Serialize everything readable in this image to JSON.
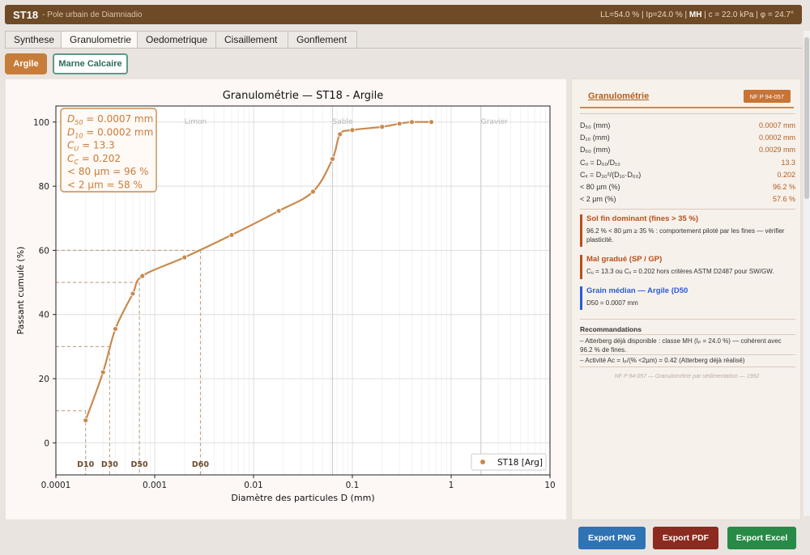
{
  "header": {
    "code": "ST18",
    "site": "- Pole urbain de Diamniadio",
    "props_pre": "LL=54.0 % | Ip=24.0 % |",
    "props_class": "MH",
    "props_post": "| c = 22.0 kPa | φ = 24.7°"
  },
  "tabs": [
    "Synthese",
    "Granulometrie",
    "Oedometrique",
    "Cisaillement",
    "Gonflement"
  ],
  "soils": [
    "Argile",
    "Marne Calcaire"
  ],
  "chart_data": {
    "type": "scatter",
    "title": "Granulométrie — ST18  - Argile",
    "xlabel": "Diamètre des particules D (mm)",
    "ylabel": "Passant cumulé (%)",
    "xscale": "log",
    "xlim": [
      0.0001,
      10
    ],
    "ylim": [
      -10,
      105
    ],
    "xticks": [
      0.0001,
      0.001,
      0.01,
      0.1,
      1,
      10
    ],
    "xtick_labels": [
      "0.0001",
      "0.001",
      "0.01",
      "0.1",
      "1",
      "10"
    ],
    "yticks": [
      0,
      20,
      40,
      60,
      80,
      100
    ],
    "grid": true,
    "legend": "bottom-right",
    "series": [
      {
        "name": "ST18  [Arg]",
        "color": "#c98a4e",
        "x": [
          0.0002,
          0.0003,
          0.0004,
          0.0006,
          0.00075,
          0.002,
          0.006,
          0.018,
          0.04,
          0.063,
          0.075,
          0.1,
          0.2,
          0.3,
          0.4,
          0.63
        ],
        "y": [
          7,
          22,
          35.5,
          46.5,
          52,
          57.8,
          64.8,
          72.3,
          78.3,
          88.5,
          96.2,
          97.5,
          98.5,
          99.5,
          100,
          100
        ]
      }
    ],
    "zones": [
      {
        "label": "Limon",
        "x": 0.002
      },
      {
        "label": "Sable",
        "x": 0.063
      },
      {
        "label": "Gravier",
        "x": 2
      }
    ],
    "markers": [
      {
        "label": "D10",
        "x": 0.0002,
        "y": 10
      },
      {
        "label": "D30",
        "x": 0.00035,
        "y": 30
      },
      {
        "label": "D50",
        "x": 0.0007,
        "y": 50
      },
      {
        "label": "D60",
        "x": 0.0029,
        "y": 60
      }
    ],
    "annotation": [
      {
        "sym": "D",
        "sub": "50",
        "text": " = 0.0007 mm"
      },
      {
        "sym": "D",
        "sub": "10",
        "text": " = 0.0002 mm"
      },
      {
        "sym": "C",
        "sub": "U",
        "text": "    = 13.3"
      },
      {
        "sym": "C",
        "sub": "C",
        "text": "    = 0.202"
      },
      {
        "sym": "",
        "sub": "",
        "text": "< 80 µm  = 96 %"
      },
      {
        "sym": "",
        "sub": "",
        "text": "< 2 µm   = 58 %"
      }
    ]
  },
  "sidebar": {
    "title": "Granulométrie",
    "norm_badge": "NF P 94-057",
    "params": [
      {
        "label": "D₅₀ (mm)",
        "value": "0.0007 mm"
      },
      {
        "label": "D₁₀ (mm)",
        "value": "0.0002 mm"
      },
      {
        "label": "D₆₀ (mm)",
        "value": "0.0029 mm"
      },
      {
        "label": "Cᵤ = D₆₀/D₁₀",
        "value": "13.3"
      },
      {
        "label": "Cₓ = D₃₀²/(D₁₀·D₆₀)",
        "value": "0.202"
      },
      {
        "label": "< 80 µm (%)",
        "value": "96.2 %"
      },
      {
        "label": "< 2 µm (%)",
        "value": "57.6 %"
      }
    ],
    "notes": [
      {
        "title": "Sol fin dominant (fines > 35 %)",
        "body": "96.2 % < 80 µm ≥ 35 % : comportement piloté par les fines — vérifier plasticité.",
        "color": "#b8501a"
      },
      {
        "title": "Mal gradué (SP / GP)",
        "body": "Cᵤ = 13.3 ou Cₓ = 0.202 hors critères ASTM D2487 pour SW/GW.",
        "color": "#b8501a"
      },
      {
        "title": "Grain médian — Argile (D50",
        "body": "D50 = 0.0007 mm",
        "color": "#2a5bd7"
      }
    ],
    "reco_title": "Recommandations",
    "recos": [
      "– Atterberg déjà disponible : classe MH (Iₚ = 24.0 %) — cohérent avec 96.2 % de fines.",
      "– Activité Ac = Iₚ/(% <2µm) = 0.42 (Atterberg déjà réalisé)"
    ],
    "footnote": "NF P 94-057 — Granulométrie par sédimentation — 1992"
  },
  "exports": [
    {
      "label": "Export PNG",
      "color": "#2f73b4"
    },
    {
      "label": "Export PDF",
      "color": "#8b2a1e"
    },
    {
      "label": "Export Excel",
      "color": "#278a46"
    }
  ]
}
